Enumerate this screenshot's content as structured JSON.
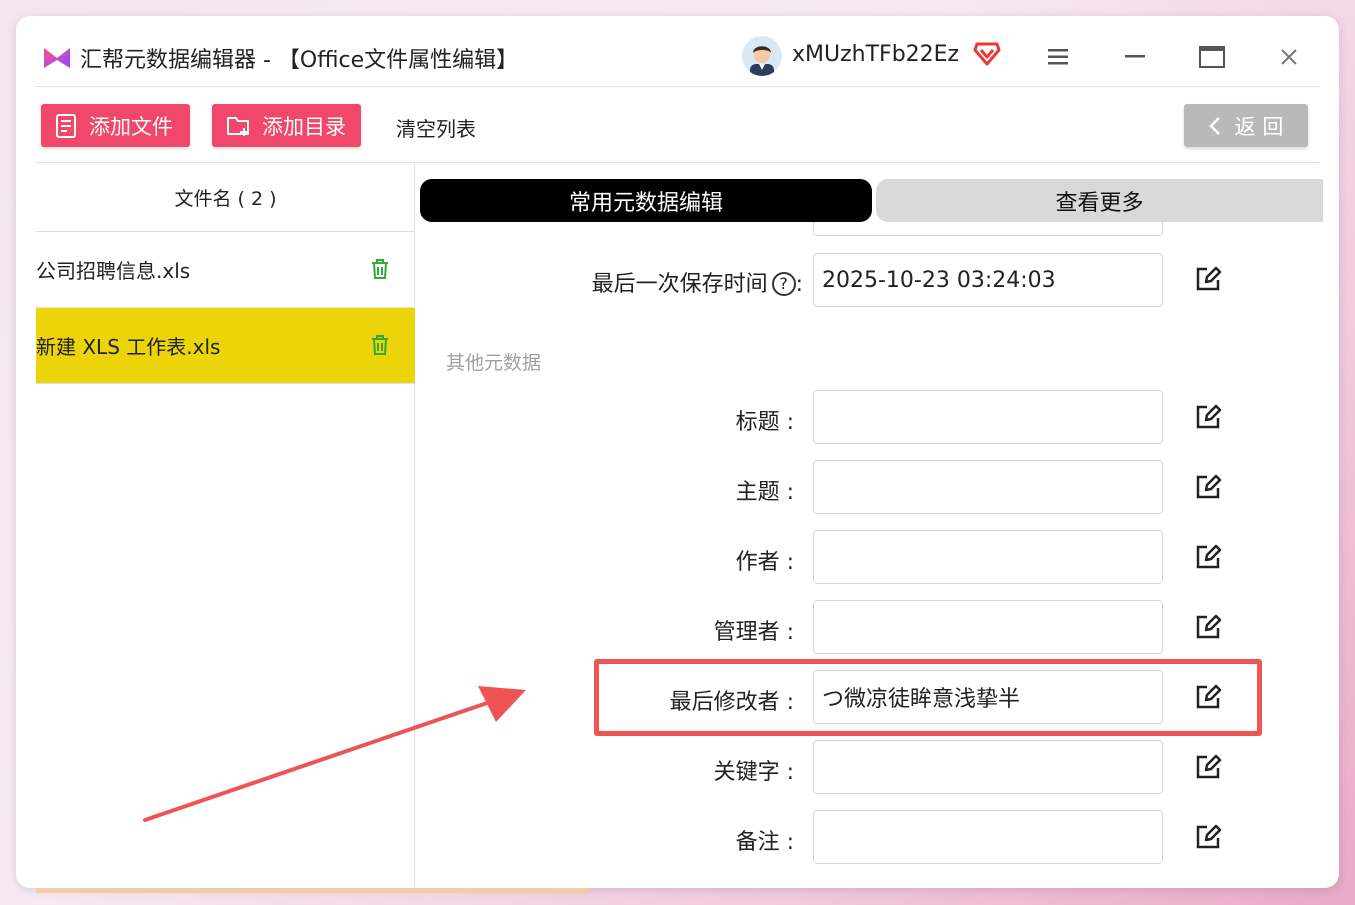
{
  "app": {
    "title": "汇帮元数据编辑器 - 【Office文件属性编辑】",
    "username": "xMUzhTFb22Ez"
  },
  "icons": {
    "logo": "app-logo-icon",
    "avatar": "user-avatar",
    "vip": "vip-diamond-icon",
    "menu": "hamburger-menu-icon",
    "minimize": "minimize-icon",
    "maximize": "maximize-icon",
    "close": "close-icon"
  },
  "colors": {
    "accent": "#f0476a",
    "selected_row": "#ecd40a",
    "highlight": "#ee5453",
    "trash": "#2faa3b"
  },
  "toolbar": {
    "add_file": "添加文件",
    "add_dir": "添加目录",
    "clear_list": "清空列表",
    "back": "返 回"
  },
  "file_list": {
    "header": "文件名 ( 2 )",
    "items": [
      {
        "name": "公司招聘信息.xls",
        "selected": false
      },
      {
        "name": "新建 XLS 工作表.xls",
        "selected": true
      }
    ]
  },
  "tabs": {
    "common": "常用元数据编辑",
    "more": "查看更多"
  },
  "fields": {
    "last_saved": {
      "label": "最后一次保存时间",
      "help": "?",
      "colon": ":",
      "value": "2025-10-23 03:24:03"
    },
    "section_other": "其他元数据",
    "title": {
      "label": "标题 :",
      "value": ""
    },
    "subject": {
      "label": "主题 :",
      "value": ""
    },
    "author": {
      "label": "作者 :",
      "value": ""
    },
    "manager": {
      "label": "管理者 :",
      "value": ""
    },
    "last_modified_by": {
      "label": "最后修改者 :",
      "value": "つ微凉徒眸意浅挚半"
    },
    "keywords": {
      "label": "关键字 :",
      "value": ""
    },
    "comments": {
      "label": "备注 :",
      "value": ""
    }
  }
}
